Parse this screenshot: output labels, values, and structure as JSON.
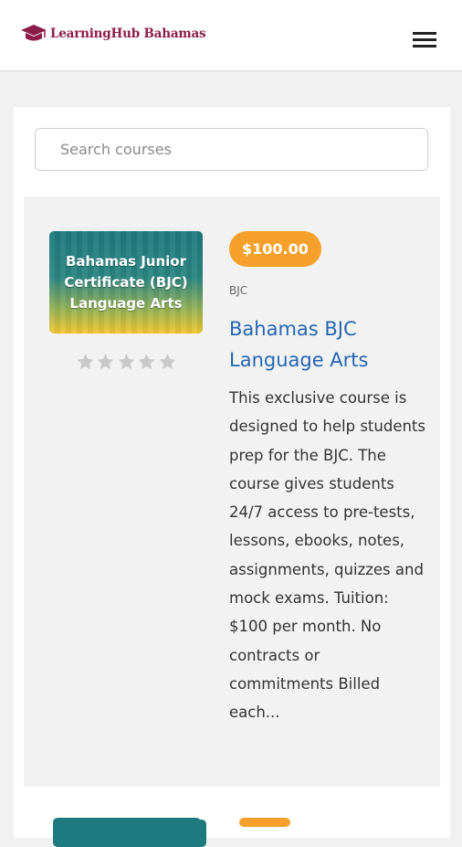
{
  "header": {
    "brand": "LearningHub Bahamas",
    "brand_color": "#8c1d4a"
  },
  "search": {
    "placeholder": "Search courses",
    "value": ""
  },
  "course": {
    "thumbnail_text": "Bahamas Junior Certificate (BJC) Language Arts",
    "rating": 0,
    "rating_max": 5,
    "price": "$100.00",
    "category": "BJC",
    "title": "Bahamas BJC Language Arts",
    "description": "This exclusive course is designed to help students prep for the BJC. The course gives students 24/7 access to pre-tests, lessons, ebooks, notes, assignments, quizzes and mock exams. Tuition: $100 per month. No contracts or commitments Billed each..."
  },
  "colors": {
    "price_badge": "#f5a02a",
    "title_link": "#2466b3",
    "thumbnail_top": "#1e7a7f",
    "thumbnail_bottom": "#f2c530"
  }
}
